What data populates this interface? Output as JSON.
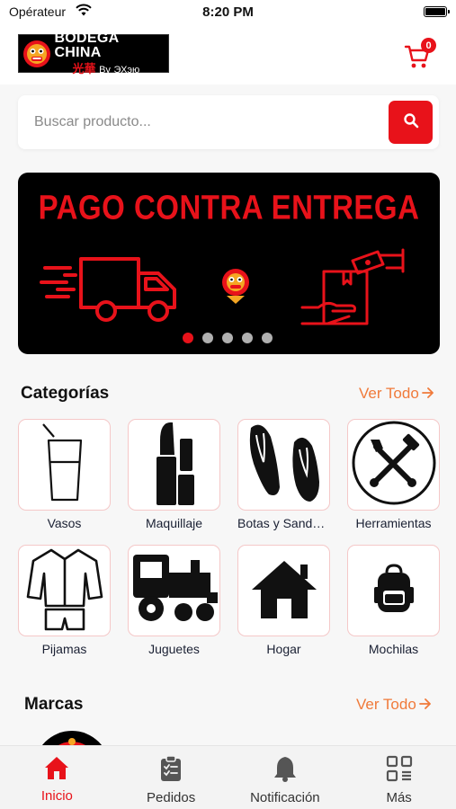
{
  "status_bar": {
    "carrier": "Opérateur",
    "time": "8:20 PM"
  },
  "header": {
    "logo_title": "BODEGA CHINA",
    "logo_chinese": "光華",
    "logo_by": "By",
    "logo_sub": "ЭХэю",
    "cart_count": "0"
  },
  "search": {
    "placeholder": "Buscar producto..."
  },
  "banner": {
    "title": "PAGO CONTRA ENTREGA",
    "slides": 5,
    "active_slide": 1
  },
  "categories": {
    "title": "Categorías",
    "see_all": "Ver Todo",
    "items": [
      {
        "label": "Vasos",
        "icon": "glass-icon"
      },
      {
        "label": "Maquillaje",
        "icon": "lipstick-icon"
      },
      {
        "label": "Botas y Sandalias",
        "icon": "flip-flops-icon"
      },
      {
        "label": "Herramientas",
        "icon": "tools-icon"
      },
      {
        "label": "Pijamas",
        "icon": "pajamas-icon"
      },
      {
        "label": "Juguetes",
        "icon": "toy-train-icon"
      },
      {
        "label": "Hogar",
        "icon": "house-icon"
      },
      {
        "label": "Mochilas",
        "icon": "backpack-icon"
      }
    ]
  },
  "brands": {
    "title": "Marcas",
    "see_all": "Ver Todo"
  },
  "nav": {
    "items": [
      {
        "label": "Inicio",
        "icon": "home-icon",
        "active": true
      },
      {
        "label": "Pedidos",
        "icon": "clipboard-icon",
        "active": false
      },
      {
        "label": "Notificación",
        "icon": "bell-icon",
        "active": false
      },
      {
        "label": "Más",
        "icon": "grid-menu-icon",
        "active": false
      }
    ]
  },
  "colors": {
    "accent": "#e8121a",
    "link": "#f07a3a",
    "category_border": "#f5c8c8"
  }
}
